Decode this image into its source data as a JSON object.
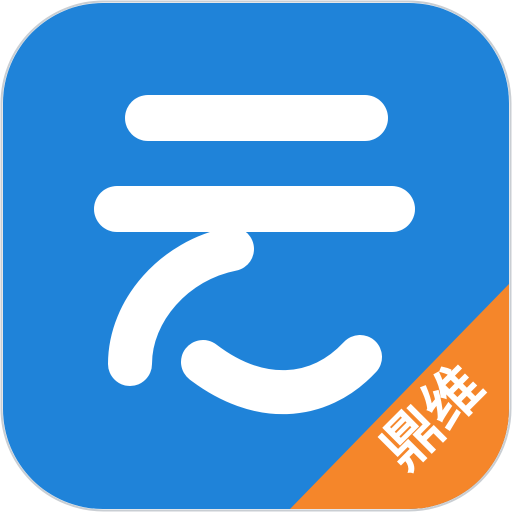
{
  "app_icon": {
    "icon_name": "cloud-character-app-icon",
    "glyph_meaning": "云",
    "background_color": "#1F83D9",
    "border_color": "#C9CED3",
    "stroke_color": "#FFFFFF"
  },
  "ribbon": {
    "label": "鼎维",
    "color": "#F5862A",
    "text_color": "#FFFFFF"
  }
}
